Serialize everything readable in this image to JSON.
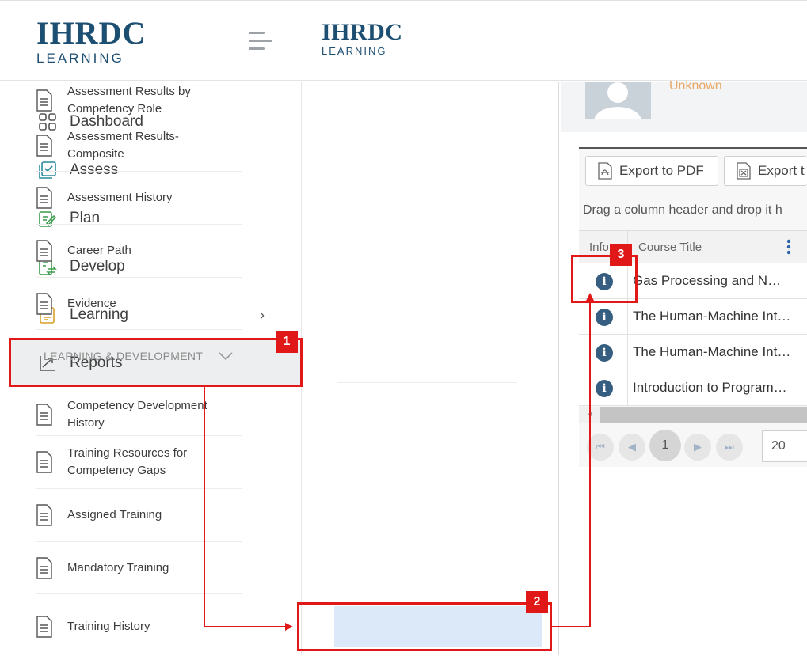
{
  "header": {
    "logo_brand": "IHRDC",
    "logo_sub": "LEARNING",
    "logo_small_brand": "IHRDC",
    "logo_small_sub": "LEARNING"
  },
  "sidebar": {
    "items": [
      {
        "label": "Dashboard",
        "icon": "grid-icon"
      },
      {
        "label": "Assess",
        "icon": "checkbox-icon"
      },
      {
        "label": "Plan",
        "icon": "clipboard-pencil-icon"
      },
      {
        "label": "Develop",
        "icon": "document-arrows-icon"
      },
      {
        "label": "Learning",
        "icon": "book-icon",
        "chevron": "›"
      },
      {
        "label": "Reports",
        "icon": "trend-up-icon"
      }
    ]
  },
  "reports_menu": {
    "items_top": [
      "Assessment Results by Competency Role",
      "Assessment Results-Composite",
      "Assessment History",
      "Career Path",
      "Evidence"
    ],
    "section_label": "LEARNING & DEVELOPMENT",
    "items_bottom": [
      "Competency Development History",
      "Training Resources for Competency Gaps",
      "Assigned Training",
      "Mandatory Training",
      "Training History"
    ]
  },
  "profile": {
    "name": "Unknown"
  },
  "grid": {
    "export_pdf": "Export to PDF",
    "export_excel": "Export t",
    "drag_hint": "Drag a column header and drop it h",
    "col_info": "Info",
    "col_title": "Course Title",
    "rows": [
      "Gas Processing and N…",
      "The Human-Machine Int…",
      "The Human-Machine Int…",
      "Introduction to Program…"
    ],
    "pager": {
      "first": "⏮",
      "prev": "◀",
      "current": "1",
      "next": "▶",
      "last": "⏭",
      "page_size": "20"
    }
  },
  "annotations": {
    "badge1": "1",
    "badge2": "2",
    "badge3": "3",
    "color": "#e01818"
  },
  "colors": {
    "brand": "#1d4f73",
    "highlight": "#dbe9f8",
    "info_icon": "#355e80",
    "profile_name": "#e8a868"
  }
}
